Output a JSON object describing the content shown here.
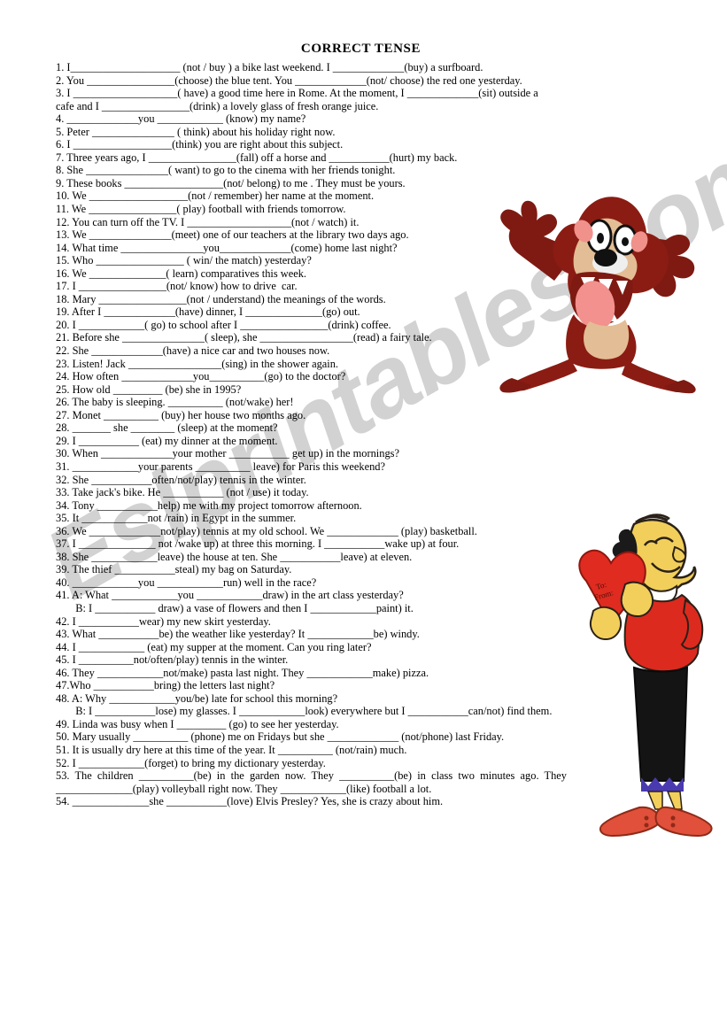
{
  "document": {
    "title": "CORRECT TENSE",
    "watermark": "Eslprintables.com",
    "colors": {
      "watermark_gray": "#c9c9c9",
      "text_black": "#000000",
      "page_background": "#ffffff",
      "taz_dark_red": "#8b1a13",
      "taz_body_red": "#a02820",
      "taz_tan": "#e8c39a",
      "taz_pink": "#f08a86",
      "olive_red": "#e02b20",
      "olive_black": "#141414",
      "olive_yellow": "#f5d04e",
      "olive_shoe_red": "#e05030",
      "olive_purple": "#4a3ab0"
    },
    "clipart": [
      {
        "name": "tasmanian-devil-taz",
        "description": "Tasmanian Devil cartoon character standing with arms raised"
      },
      {
        "name": "olive-oyl-with-heart",
        "description": "Olive Oyl cartoon character holding a red valentine heart",
        "heart_label_line1": "To:",
        "heart_label_line2": "From:"
      }
    ],
    "exercises": [
      "1. I____________________ (not / buy ) a bike last weekend. I _____________(buy) a surfboard.",
      "2. You ________________(choose) the blue tent. You _____________(not/ choose) the red one yesterday.",
      "3. I ___________________( have) a good time here in Rome. At the moment, I _____________(sit) outside a",
      "cafe and I ________________(drink) a lovely glass of fresh orange juice.",
      "4. _____________you ____________ (know) my name?",
      "5. Peter _______________ ( think) about his holiday right now.",
      "6. I __________________(think) you are right about this subject.",
      "7. Three years ago, I ________________(fall) off a horse and ___________(hurt) my back.",
      "8. She _______________( want) to go to the cinema with her friends tonight.",
      "9. These books __________________(not/ belong) to me . They must be yours.",
      "10. We __________________(not / remember) her name at the moment.",
      "11. We ________________( play) football with friends tomorrow.",
      "12. You can turn off the TV. I ___________________(not / watch) it.",
      "13. We _______________(meet) one of our teachers at the library two days ago.",
      "14. What time _______________you_____________(come) home last night?",
      "15. Who ________________ ( win/ the match) yesterday?",
      "16. We ______________( learn) comparatives this week.",
      "17. I ________________(not/ know) how to drive  car.",
      "18. Mary ________________(not / understand) the meanings of the words.",
      "19. After I _____________(have) dinner, I ______________(go) out.",
      "20. I ____________( go) to school after I ________________(drink) coffee.",
      "21. Before she _______________( sleep), she _________________(read) a fairy tale.",
      "22. She _____________(have) a nice car and two houses now.",
      "23. Listen! Jack _________________(sing) in the shower again.",
      "24. How often _____________you__________(go) to the doctor?",
      "25. How old _________ (be) she in 1995?",
      "26. The baby is sleeping. __________ (not/wake) her!",
      "27. Monet __________ (buy) her house two months ago.",
      "28. _______ she ________ (sleep) at the moment?",
      "29. I ___________ (eat) my dinner at the moment.",
      "30. When _____________your mother ___________ get up) in the mornings?",
      "31. ____________your parents __________ leave) for Paris this weekend?",
      "32. She ___________often/not/play) tennis in the winter.",
      "33. Take jack's bike. He ___________ (not / use) it today.",
      "34. Tony ___________help) me with my project tomorrow afternoon.",
      "35. It ____________not /rain) in Egypt in the summer.",
      "36. We _____________not/play) tennis at my old school. We _____________ (play) basketball.",
      "37. I ______________ not /wake up) at three this morning. I ___________wake up) at four.",
      "38. She ____________leave) the house at ten. She ___________leave) at eleven.",
      "39. The thief ___________steal) my bag on Saturday.",
      "40. ____________you ____________run) well in the race?",
      "41. A: What ____________you ____________draw) in the art class yesterday?",
      "  B: I ___________ draw) a vase of flowers and then I ____________paint) it.",
      "42. I ___________wear) my new skirt yesterday.",
      "43. What ___________be) the weather like yesterday? It ____________be) windy.",
      "44. I ____________ (eat) my supper at the moment. Can you ring later?",
      "45. I __________not/often/play) tennis in the winter.",
      "46. They ____________not/make) pasta last night. They ____________make) pizza.",
      "47.Who ___________bring) the letters last night?",
      "48. A: Why ____________you/be) late for school this morning?",
      "  B: I ___________lose) my glasses. I ____________look) everywhere but I ___________can/not) find them.",
      "49. Linda was busy when I _________ (go) to see her yesterday.",
      "50. Mary usually __________ (phone) me on Fridays but she _____________ (not/phone) last Friday.",
      "51. It is usually dry here at this time of the year. It __________ (not/rain) much.",
      "52. I ____________(forget) to bring my dictionary yesterday.",
      "53.  The  children  __________(be)  in  the  garden  now.  They  __________(be)  in  class  two  minutes  ago.  They",
      "______________(play) volleyball right now. They ____________(like) football a lot.",
      "54. ______________she ___________(love) Elvis Presley? Yes, she is crazy about him."
    ],
    "line_styles": {
      "indented": [
        42,
        50
      ],
      "justified": [
        54
      ]
    }
  }
}
